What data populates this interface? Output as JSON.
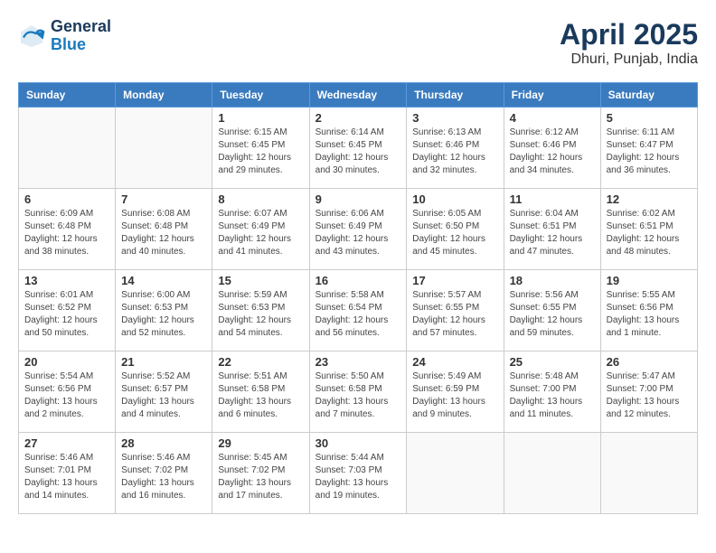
{
  "app": {
    "logo_line1": "General",
    "logo_line2": "Blue"
  },
  "title": "April 2025",
  "subtitle": "Dhuri, Punjab, India",
  "days_of_week": [
    "Sunday",
    "Monday",
    "Tuesday",
    "Wednesday",
    "Thursday",
    "Friday",
    "Saturday"
  ],
  "weeks": [
    [
      {
        "day": "",
        "sunrise": "",
        "sunset": "",
        "daylight": ""
      },
      {
        "day": "",
        "sunrise": "",
        "sunset": "",
        "daylight": ""
      },
      {
        "day": "1",
        "sunrise": "Sunrise: 6:15 AM",
        "sunset": "Sunset: 6:45 PM",
        "daylight": "Daylight: 12 hours and 29 minutes."
      },
      {
        "day": "2",
        "sunrise": "Sunrise: 6:14 AM",
        "sunset": "Sunset: 6:45 PM",
        "daylight": "Daylight: 12 hours and 30 minutes."
      },
      {
        "day": "3",
        "sunrise": "Sunrise: 6:13 AM",
        "sunset": "Sunset: 6:46 PM",
        "daylight": "Daylight: 12 hours and 32 minutes."
      },
      {
        "day": "4",
        "sunrise": "Sunrise: 6:12 AM",
        "sunset": "Sunset: 6:46 PM",
        "daylight": "Daylight: 12 hours and 34 minutes."
      },
      {
        "day": "5",
        "sunrise": "Sunrise: 6:11 AM",
        "sunset": "Sunset: 6:47 PM",
        "daylight": "Daylight: 12 hours and 36 minutes."
      }
    ],
    [
      {
        "day": "6",
        "sunrise": "Sunrise: 6:09 AM",
        "sunset": "Sunset: 6:48 PM",
        "daylight": "Daylight: 12 hours and 38 minutes."
      },
      {
        "day": "7",
        "sunrise": "Sunrise: 6:08 AM",
        "sunset": "Sunset: 6:48 PM",
        "daylight": "Daylight: 12 hours and 40 minutes."
      },
      {
        "day": "8",
        "sunrise": "Sunrise: 6:07 AM",
        "sunset": "Sunset: 6:49 PM",
        "daylight": "Daylight: 12 hours and 41 minutes."
      },
      {
        "day": "9",
        "sunrise": "Sunrise: 6:06 AM",
        "sunset": "Sunset: 6:49 PM",
        "daylight": "Daylight: 12 hours and 43 minutes."
      },
      {
        "day": "10",
        "sunrise": "Sunrise: 6:05 AM",
        "sunset": "Sunset: 6:50 PM",
        "daylight": "Daylight: 12 hours and 45 minutes."
      },
      {
        "day": "11",
        "sunrise": "Sunrise: 6:04 AM",
        "sunset": "Sunset: 6:51 PM",
        "daylight": "Daylight: 12 hours and 47 minutes."
      },
      {
        "day": "12",
        "sunrise": "Sunrise: 6:02 AM",
        "sunset": "Sunset: 6:51 PM",
        "daylight": "Daylight: 12 hours and 48 minutes."
      }
    ],
    [
      {
        "day": "13",
        "sunrise": "Sunrise: 6:01 AM",
        "sunset": "Sunset: 6:52 PM",
        "daylight": "Daylight: 12 hours and 50 minutes."
      },
      {
        "day": "14",
        "sunrise": "Sunrise: 6:00 AM",
        "sunset": "Sunset: 6:53 PM",
        "daylight": "Daylight: 12 hours and 52 minutes."
      },
      {
        "day": "15",
        "sunrise": "Sunrise: 5:59 AM",
        "sunset": "Sunset: 6:53 PM",
        "daylight": "Daylight: 12 hours and 54 minutes."
      },
      {
        "day": "16",
        "sunrise": "Sunrise: 5:58 AM",
        "sunset": "Sunset: 6:54 PM",
        "daylight": "Daylight: 12 hours and 56 minutes."
      },
      {
        "day": "17",
        "sunrise": "Sunrise: 5:57 AM",
        "sunset": "Sunset: 6:55 PM",
        "daylight": "Daylight: 12 hours and 57 minutes."
      },
      {
        "day": "18",
        "sunrise": "Sunrise: 5:56 AM",
        "sunset": "Sunset: 6:55 PM",
        "daylight": "Daylight: 12 hours and 59 minutes."
      },
      {
        "day": "19",
        "sunrise": "Sunrise: 5:55 AM",
        "sunset": "Sunset: 6:56 PM",
        "daylight": "Daylight: 13 hours and 1 minute."
      }
    ],
    [
      {
        "day": "20",
        "sunrise": "Sunrise: 5:54 AM",
        "sunset": "Sunset: 6:56 PM",
        "daylight": "Daylight: 13 hours and 2 minutes."
      },
      {
        "day": "21",
        "sunrise": "Sunrise: 5:52 AM",
        "sunset": "Sunset: 6:57 PM",
        "daylight": "Daylight: 13 hours and 4 minutes."
      },
      {
        "day": "22",
        "sunrise": "Sunrise: 5:51 AM",
        "sunset": "Sunset: 6:58 PM",
        "daylight": "Daylight: 13 hours and 6 minutes."
      },
      {
        "day": "23",
        "sunrise": "Sunrise: 5:50 AM",
        "sunset": "Sunset: 6:58 PM",
        "daylight": "Daylight: 13 hours and 7 minutes."
      },
      {
        "day": "24",
        "sunrise": "Sunrise: 5:49 AM",
        "sunset": "Sunset: 6:59 PM",
        "daylight": "Daylight: 13 hours and 9 minutes."
      },
      {
        "day": "25",
        "sunrise": "Sunrise: 5:48 AM",
        "sunset": "Sunset: 7:00 PM",
        "daylight": "Daylight: 13 hours and 11 minutes."
      },
      {
        "day": "26",
        "sunrise": "Sunrise: 5:47 AM",
        "sunset": "Sunset: 7:00 PM",
        "daylight": "Daylight: 13 hours and 12 minutes."
      }
    ],
    [
      {
        "day": "27",
        "sunrise": "Sunrise: 5:46 AM",
        "sunset": "Sunset: 7:01 PM",
        "daylight": "Daylight: 13 hours and 14 minutes."
      },
      {
        "day": "28",
        "sunrise": "Sunrise: 5:46 AM",
        "sunset": "Sunset: 7:02 PM",
        "daylight": "Daylight: 13 hours and 16 minutes."
      },
      {
        "day": "29",
        "sunrise": "Sunrise: 5:45 AM",
        "sunset": "Sunset: 7:02 PM",
        "daylight": "Daylight: 13 hours and 17 minutes."
      },
      {
        "day": "30",
        "sunrise": "Sunrise: 5:44 AM",
        "sunset": "Sunset: 7:03 PM",
        "daylight": "Daylight: 13 hours and 19 minutes."
      },
      {
        "day": "",
        "sunrise": "",
        "sunset": "",
        "daylight": ""
      },
      {
        "day": "",
        "sunrise": "",
        "sunset": "",
        "daylight": ""
      },
      {
        "day": "",
        "sunrise": "",
        "sunset": "",
        "daylight": ""
      }
    ]
  ]
}
